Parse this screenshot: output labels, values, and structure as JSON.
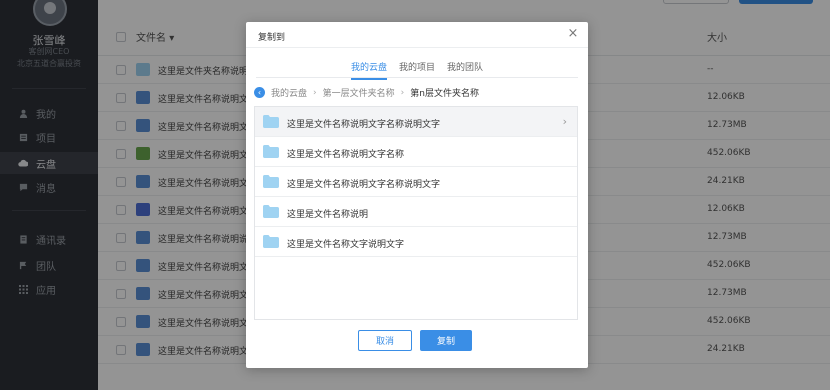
{
  "user": {
    "name": "张雪峰",
    "title": "客创网CEO",
    "company": "北京五道合赢投资"
  },
  "nav": [
    {
      "label": "我的",
      "icon": "person-icon"
    },
    {
      "label": "项目",
      "icon": "project-icon"
    },
    {
      "label": "云盘",
      "icon": "cloud-icon",
      "active": true
    },
    {
      "label": "消息",
      "icon": "message-icon"
    },
    {
      "label": "通讯录",
      "icon": "contacts-icon"
    },
    {
      "label": "团队",
      "icon": "team-icon"
    },
    {
      "label": "应用",
      "icon": "apps-icon"
    }
  ],
  "table": {
    "col_name": "文件名",
    "col_size": "大小",
    "rows": [
      {
        "name": "这里是文件夹名称说明文字",
        "size": "--",
        "type": "folder"
      },
      {
        "name": "这里是文件名称说明文字",
        "size": "12.06KB",
        "type": "doc"
      },
      {
        "name": "这里是文件名称说明文字",
        "size": "12.73MB",
        "type": "doc"
      },
      {
        "name": "这里是文件名称说明文字",
        "size": "452.06KB",
        "type": "xls"
      },
      {
        "name": "这里是文件名称说明文字",
        "size": "24.21KB",
        "type": "doc"
      },
      {
        "name": "这里是文件名称说明文字",
        "size": "12.06KB",
        "type": "video"
      },
      {
        "name": "这里是文件名称说明说明",
        "size": "12.73MB",
        "type": "doc"
      },
      {
        "name": "这里是文件名称说明文字",
        "size": "452.06KB",
        "type": "doc"
      },
      {
        "name": "这里是文件名称说明文字",
        "size": "12.73MB",
        "type": "doc"
      },
      {
        "name": "这里是文件名称说明文字",
        "size": "452.06KB",
        "type": "doc"
      },
      {
        "name": "这里是文件名称说明文字",
        "size": "24.21KB",
        "type": "doc"
      }
    ]
  },
  "dialog": {
    "title": "复制到",
    "tabs": [
      {
        "label": "我的云盘",
        "active": true
      },
      {
        "label": "我的项目",
        "active": false
      },
      {
        "label": "我的团队",
        "active": false
      }
    ],
    "breadcrumb": [
      "我的云盘",
      "第一层文件夹名称",
      "第n层文件夹名称"
    ],
    "folders": [
      "这里是文件名称说明文字名称说明文字",
      "这里是文件名称说明文字名称",
      "这里是文件名称说明文字名称说明文字",
      "这里是文件名称说明",
      "这里是文件名称文字说明文字"
    ],
    "cancel_label": "取消",
    "confirm_label": "复制"
  },
  "colors": {
    "accent": "#3a8ee6",
    "sidebar": "#2e3138",
    "folder": "#9fd3f2"
  }
}
